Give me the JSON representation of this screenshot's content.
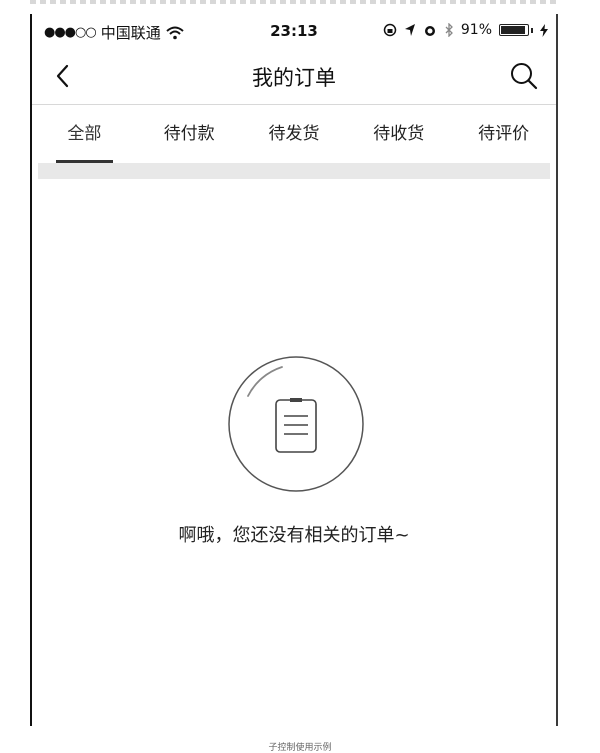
{
  "status_bar": {
    "signal": "●●●○○",
    "carrier": "中国联通",
    "time": "23:13",
    "battery": "91%",
    "battery_level": 0.91
  },
  "nav": {
    "title": "我的订单"
  },
  "tabs": [
    {
      "label": "全部",
      "active": true
    },
    {
      "label": "待付款",
      "active": false
    },
    {
      "label": "待发货",
      "active": false
    },
    {
      "label": "待收货",
      "active": false
    },
    {
      "label": "待评价",
      "active": false
    }
  ],
  "empty_state": {
    "message": "啊哦，您还没有相关的订单~"
  },
  "caption": "子控制使用示例"
}
